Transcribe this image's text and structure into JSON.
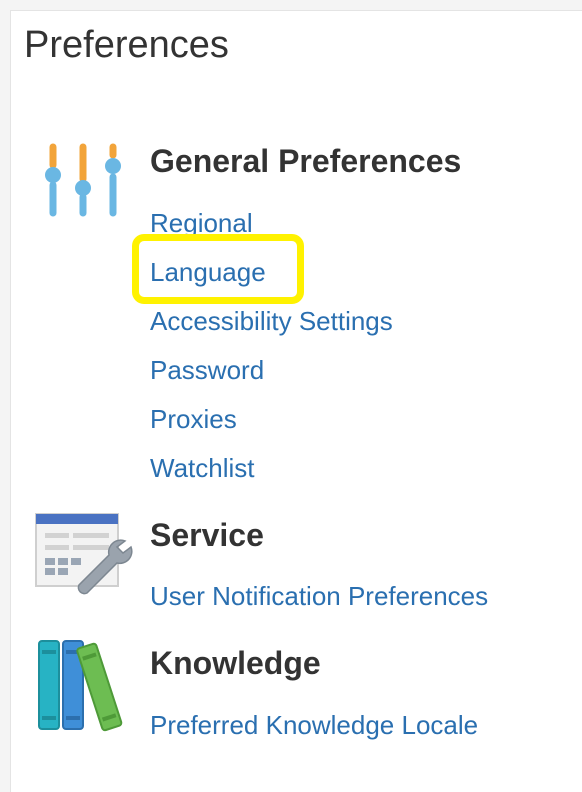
{
  "page": {
    "title": "Preferences"
  },
  "sections": [
    {
      "title": "General Preferences",
      "icon": "sliders-icon",
      "links": [
        "Regional",
        "Language",
        "Accessibility Settings",
        "Password",
        "Proxies",
        "Watchlist"
      ]
    },
    {
      "title": "Service",
      "icon": "form-wrench-icon",
      "links": [
        "User Notification Preferences"
      ]
    },
    {
      "title": "Knowledge",
      "icon": "books-icon",
      "links": [
        "Preferred Knowledge Locale"
      ]
    }
  ],
  "colors": {
    "link": "#2a6fb0",
    "heading": "#333333",
    "highlight": "#fff200",
    "slider_orange": "#f2a43a",
    "slider_blue": "#6ab7e3"
  }
}
